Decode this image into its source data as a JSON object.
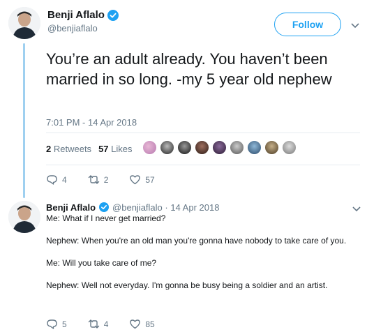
{
  "tweet": {
    "author_name": "Benji Aflalo",
    "author_handle": "@benjiaflalo",
    "follow_label": "Follow",
    "text": "You’re an adult already. You haven’t been married in so long. -my 5 year old nephew",
    "timestamp": "7:01 PM - 14 Apr 2018",
    "retweets_count": "2",
    "retweets_label": "Retweets",
    "likes_count": "57",
    "likes_label": "Likes",
    "reply_action_count": "4",
    "retweet_action_count": "2",
    "like_action_count": "57"
  },
  "reply": {
    "author_name": "Benji Aflalo",
    "meta": "@benjiaflalo · 14 Apr 2018",
    "lines": [
      "Me: What if I never get married?",
      "Nephew: When you're an old man you're gonna have nobody to take care of you.",
      "Me: Will you take care of me?",
      "Nephew: Well not everyday. I'm gonna be busy being a soldier and an artist."
    ],
    "reply_count": "5",
    "retweet_count": "4",
    "like_count": "85"
  },
  "icons": {
    "verified": "verified-badge-icon",
    "caret": "chevron-down-icon",
    "reply": "reply-icon",
    "retweet": "retweet-icon",
    "like": "heart-icon"
  },
  "colors": {
    "accent": "#1da1f2",
    "muted": "#657786",
    "thread_line": "#9fd0f0"
  }
}
